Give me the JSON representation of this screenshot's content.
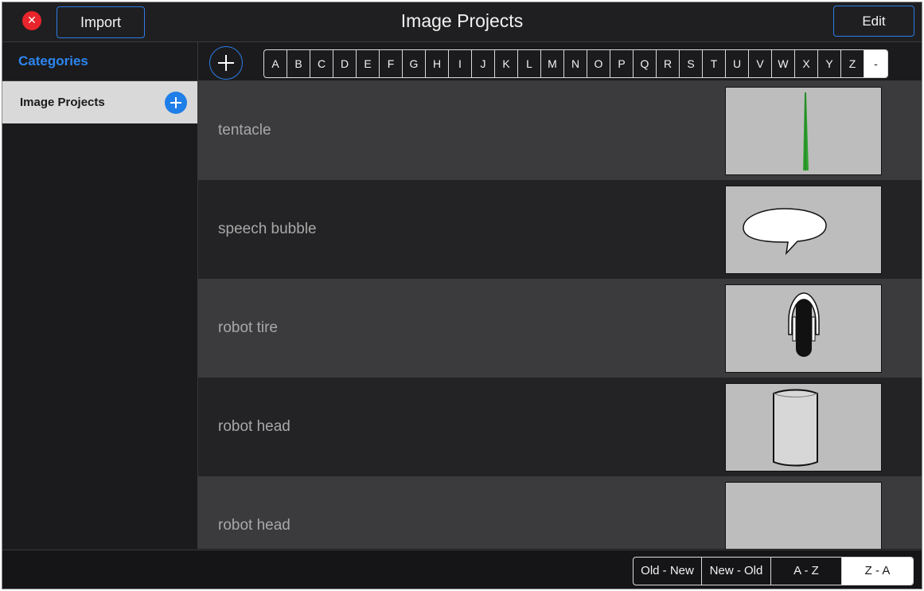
{
  "header": {
    "close_glyph": "✕",
    "import_label": "Import",
    "title": "Image Projects",
    "edit_label": "Edit"
  },
  "sidebar": {
    "heading": "Categories",
    "items": [
      {
        "label": "Image Projects",
        "selected": true
      }
    ]
  },
  "alphabet": {
    "letters": [
      "A",
      "B",
      "C",
      "D",
      "E",
      "F",
      "G",
      "H",
      "I",
      "J",
      "K",
      "L",
      "M",
      "N",
      "O",
      "P",
      "Q",
      "R",
      "S",
      "T",
      "U",
      "V",
      "W",
      "X",
      "Y",
      "Z",
      "-"
    ],
    "active": "-"
  },
  "projects": [
    {
      "name": "tentacle",
      "thumbnail": "tentacle-image"
    },
    {
      "name": "speech bubble",
      "thumbnail": "speech-bubble-image"
    },
    {
      "name": "robot tire",
      "thumbnail": "robot-tire-image"
    },
    {
      "name": "robot head",
      "thumbnail": "robot-head-image"
    },
    {
      "name": "robot head",
      "thumbnail": "blank-image"
    }
  ],
  "sort": {
    "options": [
      "Old - New",
      "New - Old",
      "A - Z",
      "Z - A"
    ],
    "active": "Z - A"
  },
  "colors": {
    "accent": "#2b7be6",
    "close": "#e8242c",
    "tentacle": "#2fa32f"
  }
}
